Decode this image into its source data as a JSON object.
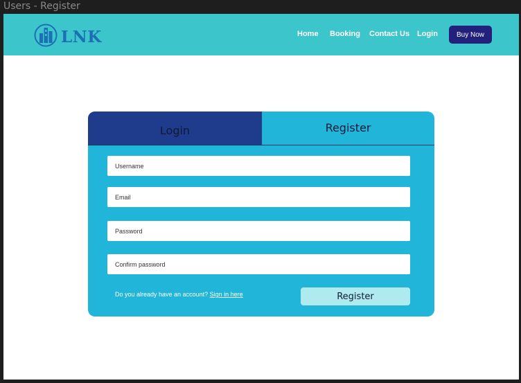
{
  "window": {
    "title": "Users - Register"
  },
  "header": {
    "logo_text": "LNK",
    "nav": [
      "Home",
      "Booking",
      "Contact Us",
      "Login"
    ],
    "cta": "Buy Now"
  },
  "auth": {
    "tabs": {
      "login": "Login",
      "register": "Register"
    },
    "fields": {
      "username": "Username",
      "email": "Email",
      "password": "Password",
      "confirm_password": "Confirm password"
    },
    "account_prompt": "Do you already have an account?",
    "signin_link": "Sign in here",
    "submit": "Register"
  },
  "colors": {
    "navbar": "#3cc6cb",
    "card": "#22b5da",
    "login_tab": "#1e3b8c",
    "cta": "#22207a",
    "submit": "#aeeaee",
    "logo": "#1b6fb3"
  }
}
